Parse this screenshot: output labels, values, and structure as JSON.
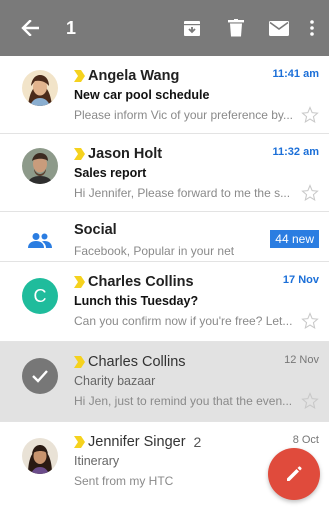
{
  "toolbar": {
    "selected_count": "1",
    "back_icon": "arrow-left-icon",
    "archive_icon": "archive-icon",
    "delete_icon": "trash-icon",
    "mail_icon": "mail-icon",
    "more_icon": "more-vert-icon",
    "background": "#7a7a7a"
  },
  "messages": [
    {
      "sender": "Angela Wang",
      "time": "11:41 am",
      "subject": "New car pool schedule",
      "snippet": "Please inform Vic of your preference by...",
      "unread": true,
      "starred": false
    },
    {
      "sender": "Jason Holt",
      "time": "11:32 am",
      "subject": "Sales report",
      "snippet": "Hi Jennifer, Please forward to me the s...",
      "unread": true,
      "starred": false
    },
    {
      "sender": "Charles Collins",
      "avatar_letter": "C",
      "time": "17 Nov",
      "subject": "Lunch this Tuesday?",
      "snippet": "Can you confirm now if you're free? Let...",
      "unread": true,
      "starred": false
    },
    {
      "sender": "Charles Collins",
      "time": "12 Nov",
      "subject": "Charity bazaar",
      "snippet": "Hi Jen, just to remind you that the even...",
      "unread": false,
      "selected": true,
      "starred": false
    },
    {
      "sender": "Jennifer Singer",
      "thread_count": "2",
      "time": "8 Oct",
      "subject": "Itinerary",
      "snippet": "Sent from my HTC",
      "unread": false,
      "starred": false
    }
  ],
  "social": {
    "title": "Social",
    "snippet": "Facebook, Popular in your net",
    "badge": "44 new",
    "icon": "people-icon",
    "accent": "#2b7de1"
  },
  "colors": {
    "time_unread": "#1b6fd8",
    "important_marker": "#f5d21e",
    "fab": "#e04b3c",
    "letter_avatar": "#1fbc9c"
  },
  "compose": {
    "icon": "pencil-icon"
  }
}
